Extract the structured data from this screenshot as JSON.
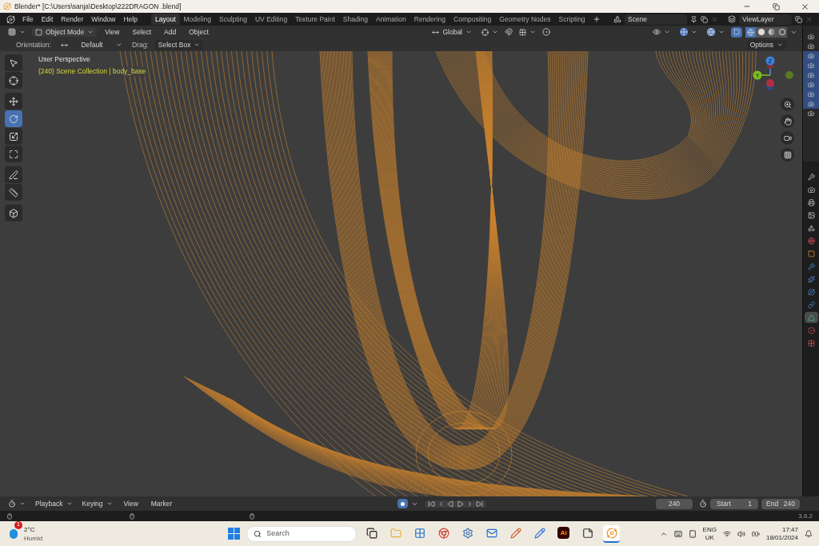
{
  "window": {
    "title": "Blender* [C:\\Users\\sanja\\Desktop\\222DRAGON .blend]"
  },
  "menu": [
    "File",
    "Edit",
    "Render",
    "Window",
    "Help"
  ],
  "workspaces": [
    {
      "label": "Layout",
      "selected": true
    },
    {
      "label": "Modeling",
      "selected": false
    },
    {
      "label": "Sculpting",
      "selected": false
    },
    {
      "label": "UV Editing",
      "selected": false
    },
    {
      "label": "Texture Paint",
      "selected": false
    },
    {
      "label": "Shading",
      "selected": false
    },
    {
      "label": "Animation",
      "selected": false
    },
    {
      "label": "Rendering",
      "selected": false
    },
    {
      "label": "Compositing",
      "selected": false
    },
    {
      "label": "Geometry Nodes",
      "selected": false
    },
    {
      "label": "Scripting",
      "selected": false
    }
  ],
  "scene": {
    "value": "Scene"
  },
  "view_layer": {
    "value": "ViewLayer"
  },
  "header": {
    "mode": "Object Mode",
    "menus": [
      "View",
      "Select",
      "Add",
      "Object"
    ],
    "transform": "Global",
    "xray": true,
    "shading": [
      {
        "kind": "wireframe",
        "selected": true
      },
      {
        "kind": "solid",
        "selected": false
      },
      {
        "kind": "material",
        "selected": false
      },
      {
        "kind": "rendered",
        "selected": false
      }
    ]
  },
  "tool_settings": {
    "orientation_label": "Orientation:",
    "orientation": "Default",
    "drag_label": "Drag:",
    "drag": "Select Box",
    "options": "Options"
  },
  "viewport": {
    "view_name": "User Perspective",
    "collection": "(240) Scene Collection | body_base"
  },
  "tools": [
    {
      "kind": "select",
      "selected": false
    },
    {
      "kind": "cursor",
      "selected": false
    },
    {
      "kind": "move",
      "selected": false
    },
    {
      "kind": "rotate",
      "selected": true
    },
    {
      "kind": "scale",
      "selected": false
    },
    {
      "kind": "transform",
      "selected": false
    },
    {
      "kind": "annotate",
      "selected": false
    },
    {
      "kind": "measure",
      "selected": false
    },
    {
      "kind": "add_cube",
      "selected": false
    }
  ],
  "gizmo": {
    "z": "Z",
    "y": "Y"
  },
  "outliner_rows": [
    {
      "selected": false
    },
    {
      "selected": false
    },
    {
      "selected": true
    },
    {
      "selected": true
    },
    {
      "selected": true
    },
    {
      "selected": true
    },
    {
      "selected": true
    },
    {
      "selected": true
    },
    {
      "selected": false
    }
  ],
  "properties_tabs": [
    {
      "kind": "tool",
      "selected": false
    },
    {
      "kind": "render",
      "selected": false
    },
    {
      "kind": "output",
      "selected": false
    },
    {
      "kind": "view_layer",
      "selected": false
    },
    {
      "kind": "scene",
      "selected": false
    },
    {
      "kind": "world",
      "selected": false
    },
    {
      "kind": "object",
      "selected": false
    },
    {
      "kind": "modifier",
      "selected": false
    },
    {
      "kind": "particles",
      "selected": false
    },
    {
      "kind": "physics",
      "selected": false
    },
    {
      "kind": "constraints",
      "selected": false
    },
    {
      "kind": "data",
      "selected": true
    },
    {
      "kind": "material",
      "selected": false
    },
    {
      "kind": "texture",
      "selected": false
    }
  ],
  "timeline": {
    "menus": [
      {
        "label": "Playback",
        "dropdown": true
      },
      {
        "label": "Keying",
        "dropdown": true
      },
      {
        "label": "View",
        "dropdown": false
      },
      {
        "label": "Marker",
        "dropdown": false
      }
    ],
    "auto_keying": true,
    "current_frame": "240",
    "start_label": "Start",
    "start": "1",
    "end_label": "End",
    "end": "240"
  },
  "status": {
    "version": "3.6.2"
  },
  "taskbar": {
    "weather_badge": "1",
    "temperature": "2°C",
    "weather": "Humid",
    "search_placeholder": "Search",
    "apps": [
      {
        "kind": "task_view",
        "selected": false
      },
      {
        "kind": "files",
        "selected": false
      },
      {
        "kind": "store",
        "selected": false
      },
      {
        "kind": "browser",
        "selected": false
      },
      {
        "kind": "settings",
        "selected": false
      },
      {
        "kind": "mail",
        "selected": false
      },
      {
        "kind": "sketch",
        "selected": false
      },
      {
        "kind": "whiteboard",
        "selected": false
      },
      {
        "kind": "illustrator",
        "label": "Ai",
        "selected": false
      },
      {
        "kind": "notes",
        "selected": false
      },
      {
        "kind": "blender",
        "selected": true
      }
    ],
    "language": "ENG",
    "region": "UK",
    "time": "17:47",
    "date": "18/01/2024"
  }
}
